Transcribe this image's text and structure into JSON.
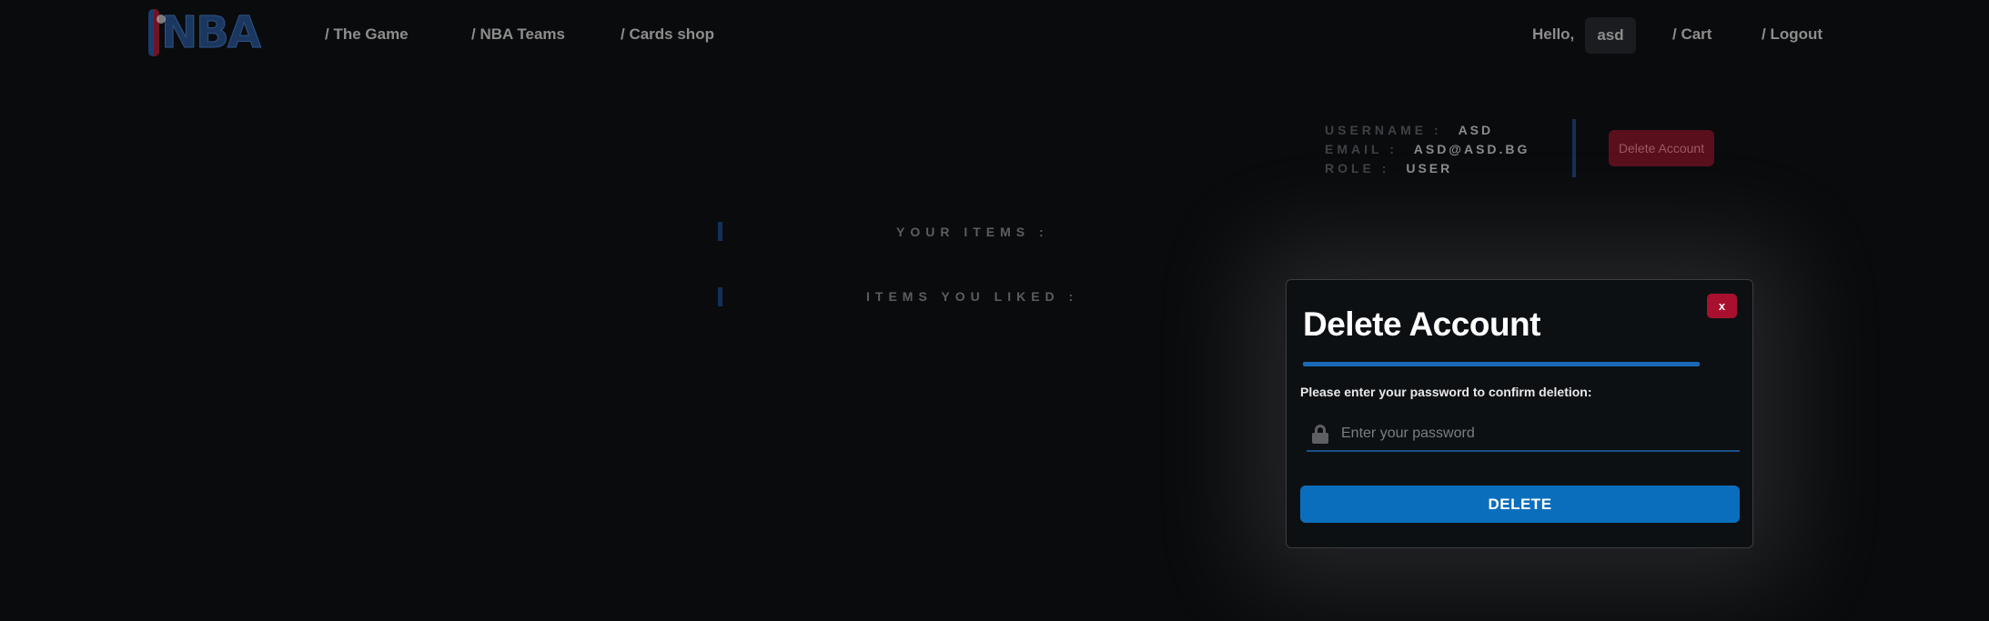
{
  "header": {
    "logo_text": "NBA",
    "nav": [
      {
        "label": "/ The Game"
      },
      {
        "label": "/ NBA Teams"
      },
      {
        "label": "/ Cards shop"
      }
    ],
    "greeting": "Hello,",
    "username_chip": "asd",
    "cart_label": "/ Cart",
    "logout_label": "/ Logout"
  },
  "profile": {
    "username_label": "USERNAME :",
    "username_value": "ASD",
    "email_label": "EMAIL :",
    "email_value": "ASD@ASD.BG",
    "role_label": "ROLE :",
    "role_value": "USER",
    "delete_account_label": "Delete Account"
  },
  "sections": {
    "your_items": "YOUR ITEMS :",
    "items_liked": "ITEMS YOU LIKED :"
  },
  "modal": {
    "close_label": "x",
    "title": "Delete Account",
    "prompt": "Please enter your password to confirm deletion:",
    "password_placeholder": "Enter your password",
    "password_value": "",
    "submit_label": "DELETE"
  },
  "colors": {
    "background": "#0a0b0d",
    "accent_blue": "#0a6ebd",
    "danger_red": "#a8102e"
  }
}
